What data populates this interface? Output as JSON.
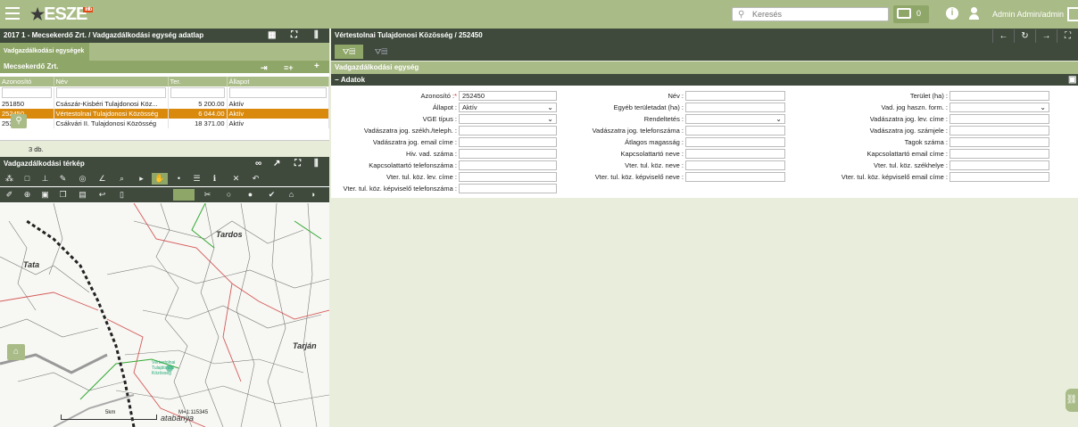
{
  "topbar": {
    "logo_text": "ESZE",
    "logo_tag": "info",
    "search_placeholder": "Keresés",
    "message_count": "0",
    "user_name": "Admin Admin/admin"
  },
  "left": {
    "window_title": "2017 1 - Mecsekerdő Zrt. / Vadgazdálkodási egység adatlap",
    "tab_label": "Vadgazdálkodási egységek",
    "section_title": "Mecsekerdő Zrt.",
    "columns": [
      "Azonosító",
      "Név",
      "Ter.",
      "Állapot"
    ],
    "rows": [
      {
        "id": "251850",
        "name": "Császár-Kisbéri Tulajdonosi Köz...",
        "area": "5 200.00",
        "status": "Aktív"
      },
      {
        "id": "252450",
        "name": "Vértestolnai Tulajdonosi Közösség",
        "area": "6 044.00",
        "status": "Aktív"
      },
      {
        "id": "253950",
        "name": "Csákvári II. Tulajdonosi Közösség",
        "area": "18 371.00",
        "status": "Aktív"
      }
    ],
    "count_label": "3 db.",
    "map_title": "Vadgazdálkodási térkép",
    "map_places": [
      "Tardos",
      "Tata",
      "Tarján",
      "atabánya",
      "Vértestolnai Tulajdonosi Közösség"
    ],
    "scale_text": "M=1:115345",
    "scale_km": "5km"
  },
  "right": {
    "window_title": "Vértestolnai Tulajdonosi Közösség / 252450",
    "section_title": "Vadgazdálkodási egység",
    "subsection_title": "Adatok",
    "fields": {
      "azonosito_label": "Azonosító :",
      "azonosito_value": "252450",
      "allapot_label": "Állapot :",
      "allapot_value": "Aktív",
      "vge_label": "VGE típus :",
      "szekh_label": "Vadászatra jog. székh./teleph. :",
      "email_label": "Vadászatra jog. email címe :",
      "hiv_label": "Hiv. vad. száma :",
      "kapcs_tel_label": "Kapcsolattartó telefonszáma :",
      "vter_lev_label": "Vter. tul. köz. lev. címe :",
      "vter_kepv_tel_label": "Vter. tul. köz. képviselő telefonszáma :",
      "nev_label": "Név :",
      "egyeb_label": "Egyéb területadat (ha) :",
      "rendelt_label": "Rendeltetés :",
      "jog_tel_label": "Vadászatra jog. telefonszáma :",
      "magassag_label": "Átlagos magasság :",
      "kapcs_nev_label": "Kapcsolattartó neve :",
      "vter_nev_label": "Vter. tul. köz. neve :",
      "vter_kepv_nev_label": "Vter. tul. köz. képviselő neve :",
      "terulet_label": "Terület (ha) :",
      "haszn_label": "Vad. jog haszn. form. :",
      "lev_cim_label": "Vadászatra jog. lev. címe :",
      "szamjel_label": "Vadászatra jog. számjele :",
      "tagok_label": "Tagok száma :",
      "kapcs_email_label": "Kapcsolattartó email címe :",
      "vter_szekh_label": "Vter. tul. köz. székhelye :",
      "vter_kepv_email_label": "Vter. tul. köz. képviselő email címe :"
    }
  },
  "colors": {
    "accent": "#a9bb86",
    "dark": "#3f4a3c",
    "selected": "#d98a0d"
  }
}
